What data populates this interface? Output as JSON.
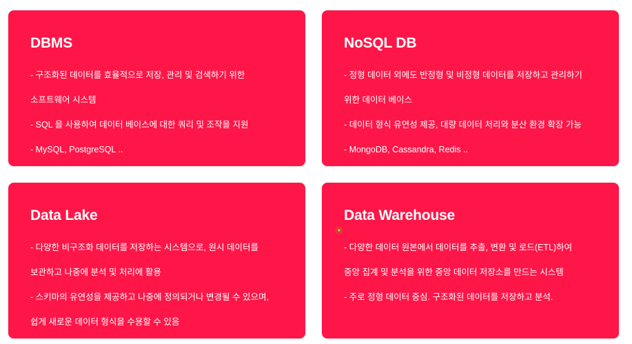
{
  "theme": {
    "card_color": "#fe1648",
    "text_color": "#ffffff",
    "page_background": "#ffffff"
  },
  "cards": [
    {
      "title": "DBMS",
      "lines": [
        "- 구조화된 데이터를 효율적으로 저장, 관리 및 검색하기 위한",
        "소프트웨어 시스템",
        "- SQL 을 사용하여 데이터 베이스에 대한 쿼리 및 조작을 지원",
        "- MySQL, PostgreSQL .."
      ]
    },
    {
      "title": "NoSQL DB",
      "lines": [
        "- 정형 데이터 외에도 반정형 및 비정형 데이터를 저장하고 관리하기",
        "위한 데이터 베이스",
        "- 데이터 형식 유연성 제공, 대량 데이터 처리와 분산 환경 확장 가능",
        "- MongoDB, Cassandra, Redis .."
      ]
    },
    {
      "title": "Data Lake",
      "lines": [
        "- 다양한 비구조화 데이터를 저장하는 시스템으로, 원시 데이터를",
        "보관하고 나중에 분석 및 처리에 활용",
        "- 스키마의 유연성을 제공하고 나중에 정의되거나 변경될 수 있으며,",
        "쉽게 새로운 데이터 형식을 수용할 수 있음"
      ]
    },
    {
      "title": "Data Warehouse",
      "lines": [
        "- 다양한 데이터 원본에서 데이터를 추출, 변환 및 로드(ETL)하여",
        "중앙 집계 및 분석을 위한 중앙 데이터 저장소를 만드는 시스템",
        "- 주로 정형 데이터 중심. 구조화된 데이터를 저장하고 분석."
      ]
    }
  ]
}
